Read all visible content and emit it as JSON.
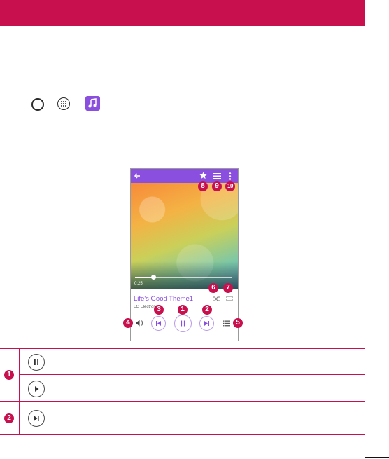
{
  "player": {
    "time": "0:25",
    "song_title": "Life's Good Theme1",
    "artist": "LG Electronics",
    "progress_fraction": 0.2
  },
  "callouts": {
    "c1": "1",
    "c2": "2",
    "c3": "3",
    "c4": "4",
    "c5": "5",
    "c6": "6",
    "c7": "7",
    "c8": "8",
    "c9": "9",
    "c10": "10"
  },
  "table": {
    "row1_num": "1",
    "row2_num": "2"
  },
  "colors": {
    "accent": "#c8104f",
    "player_purple": "#8b4fe0"
  },
  "icons": {
    "nav": [
      "home-icon",
      "apps-icon",
      "music-app-icon"
    ],
    "toolbar": [
      "back-icon",
      "star-icon",
      "playlist-icon",
      "more-icon"
    ],
    "controls": [
      "shuffle-icon",
      "repeat-icon",
      "volume-icon",
      "previous-icon",
      "pause-icon",
      "next-icon",
      "list-icon"
    ]
  }
}
